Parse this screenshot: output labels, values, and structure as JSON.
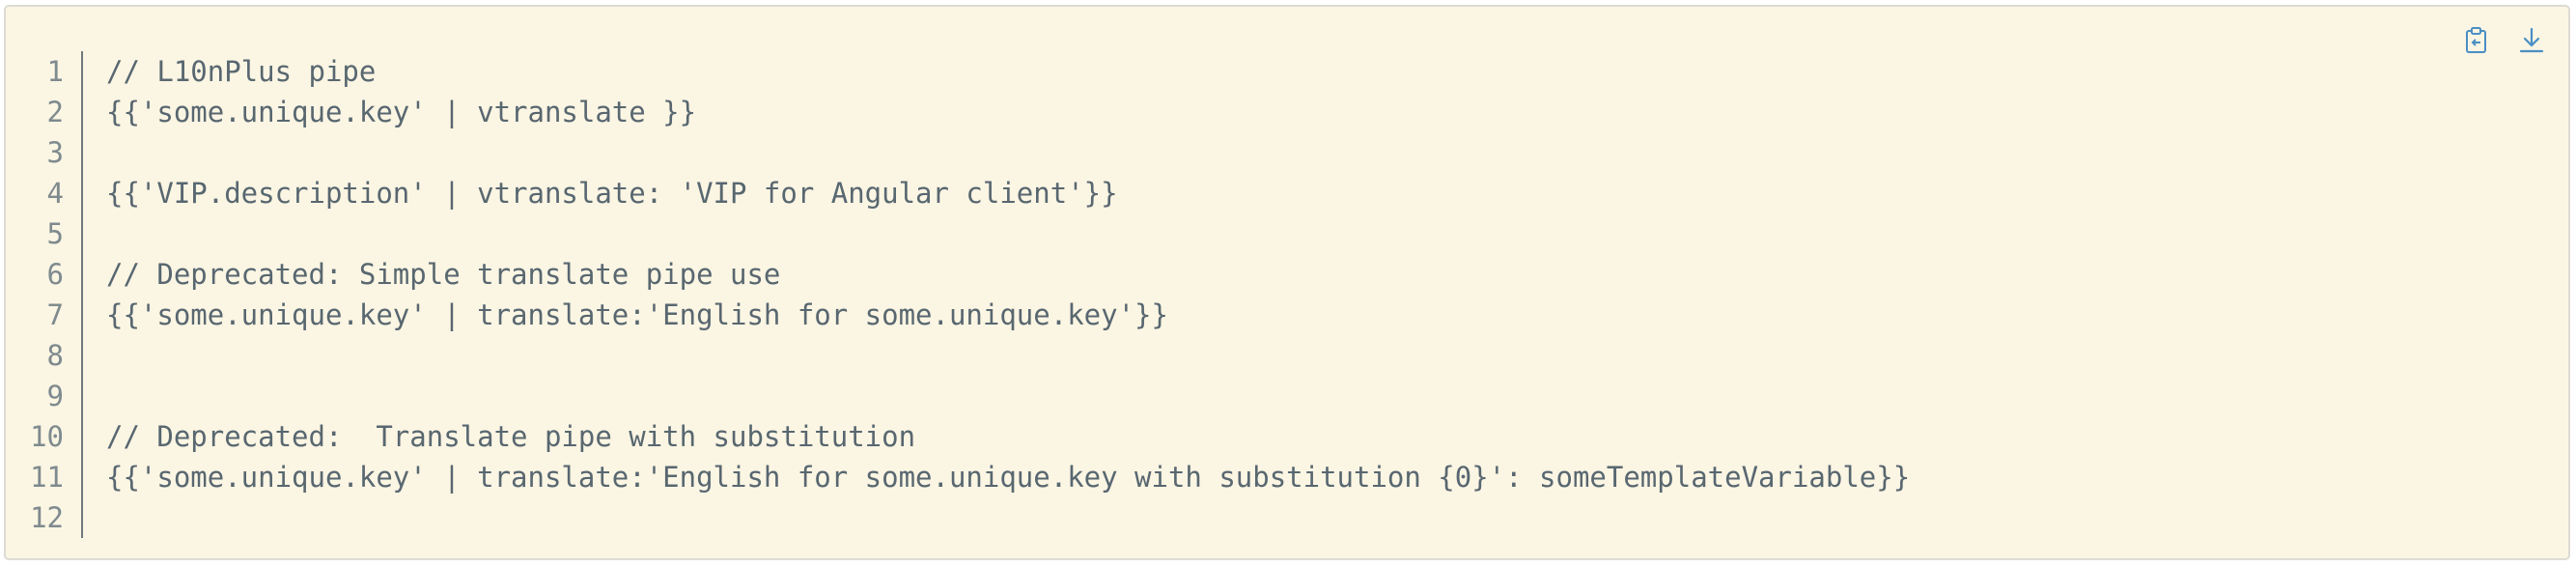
{
  "toolbar": {
    "copy_icon": "clipboard-copy-icon",
    "download_icon": "download-icon",
    "icon_color": "#4a8fc5"
  },
  "editor": {
    "background": "#fbf5e3",
    "line_numbers": [
      "1",
      "2",
      "3",
      "4",
      "5",
      "6",
      "7",
      "8",
      "9",
      "10",
      "11",
      "12"
    ],
    "lines": [
      "// L10nPlus pipe",
      "{{'some.unique.key' | vtranslate }}",
      "",
      "{{'VIP.description' | vtranslate: 'VIP for Angular client'}}",
      "",
      "// Deprecated: Simple translate pipe use",
      "{{'some.unique.key' | translate:'English for some.unique.key'}}",
      "",
      "",
      "// Deprecated:  Translate pipe with substitution",
      "{{'some.unique.key' | translate:'English for some.unique.key with substitution {0}': someTemplateVariable}}",
      ""
    ]
  }
}
